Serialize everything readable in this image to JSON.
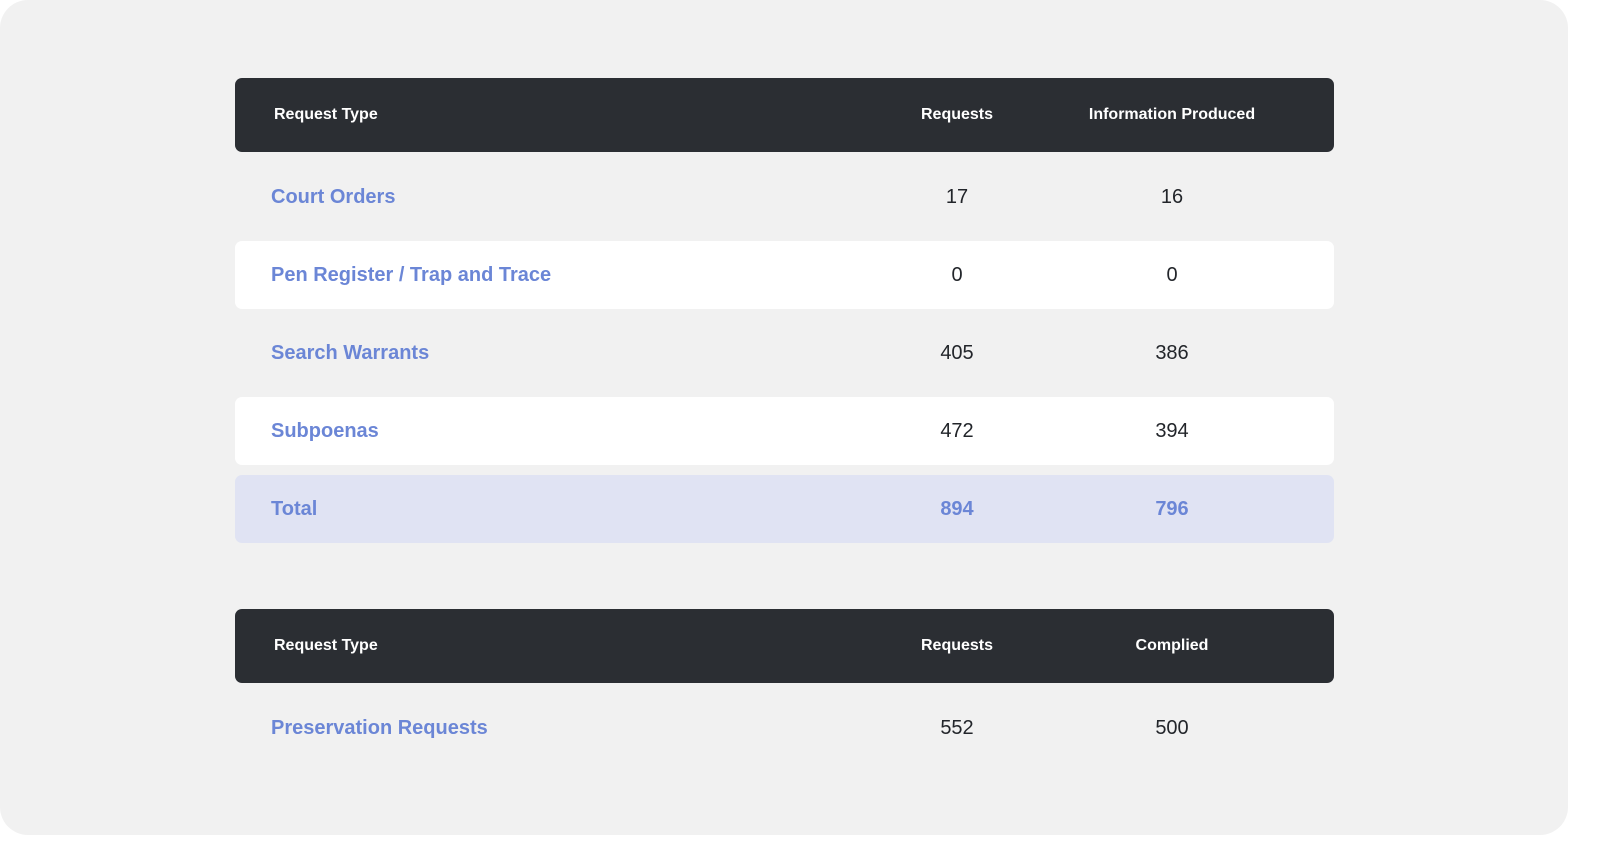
{
  "table1": {
    "header": {
      "type": "Request Type",
      "requests": "Requests",
      "info": "Information Produced"
    },
    "rows": [
      {
        "type": "Court Orders",
        "requests": "17",
        "info": "16"
      },
      {
        "type": "Pen Register / Trap and Trace",
        "requests": "0",
        "info": "0"
      },
      {
        "type": "Search Warrants",
        "requests": "405",
        "info": "386"
      },
      {
        "type": "Subpoenas",
        "requests": "472",
        "info": "394"
      }
    ],
    "total": {
      "type": "Total",
      "requests": "894",
      "info": "796"
    }
  },
  "table2": {
    "header": {
      "type": "Request Type",
      "requests": "Requests",
      "complied": "Complied"
    },
    "rows": [
      {
        "type": "Preservation Requests",
        "requests": "552",
        "complied": "500"
      }
    ]
  },
  "colors": {
    "header_bg": "#2b2e33",
    "link_blue": "#6b86d6",
    "total_bg": "#e0e3f3",
    "page_bg": "#f1f1f1"
  }
}
